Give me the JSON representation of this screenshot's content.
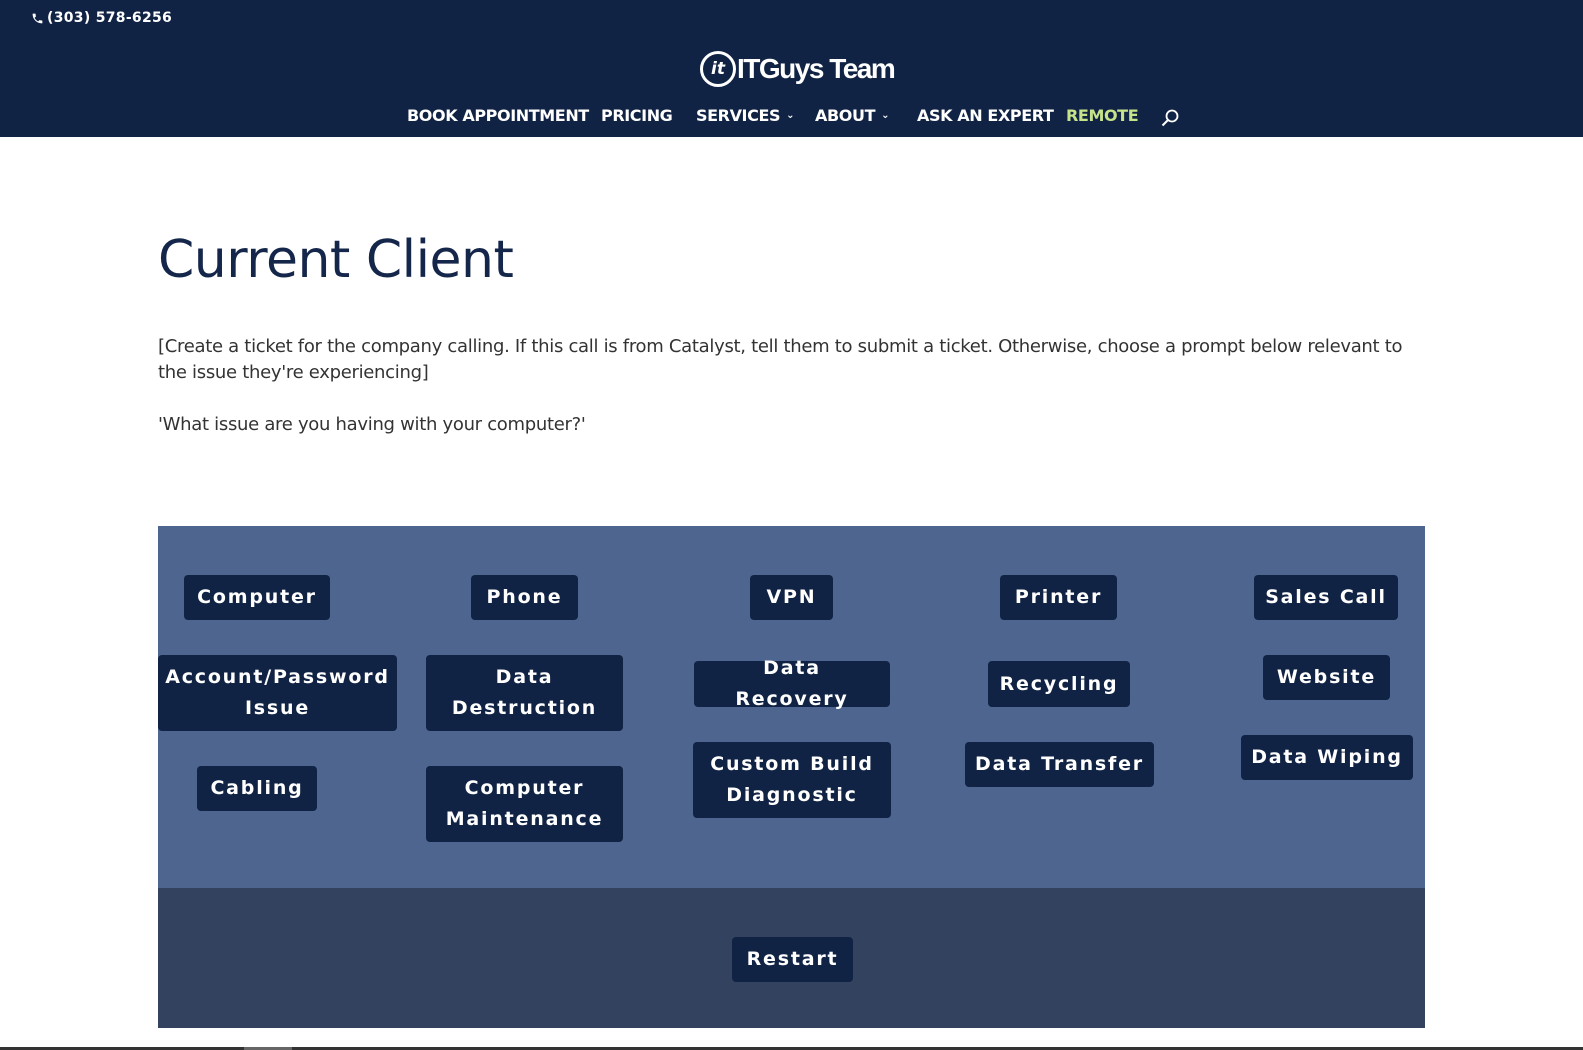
{
  "header": {
    "phone": "(303) 578-6256",
    "logo_mark": "it",
    "logo_text": "ITGuys Team",
    "nav": [
      {
        "label": "BOOK APPOINTMENT",
        "has_dropdown": false
      },
      {
        "label": "PRICING",
        "has_dropdown": false
      },
      {
        "label": "SERVICES",
        "has_dropdown": true
      },
      {
        "label": "ABOUT",
        "has_dropdown": true
      },
      {
        "label": "ASK AN EXPERT",
        "has_dropdown": false
      },
      {
        "label": "REMOTE",
        "has_dropdown": false
      }
    ],
    "icons": {
      "phone": "phone-icon",
      "search": "search-icon",
      "dropdown": "chevron-down-icon"
    }
  },
  "main": {
    "title": "Current Client",
    "instruction": "[Create a ticket for the company calling. If this call is from Catalyst, tell them to submit a ticket. Otherwise, choose a prompt below relevant to the issue they're experiencing]",
    "prompt": "'What issue are you having with your computer?'"
  },
  "buttons": {
    "computer": "Computer",
    "phone": "Phone",
    "vpn": "VPN",
    "printer": "Printer",
    "sales_call": "Sales Call",
    "account_password": "Account/Password Issue",
    "data_destruction": "Data Destruction",
    "data_recovery": "Data Recovery",
    "recycling": "Recycling",
    "website": "Website",
    "cabling": "Cabling",
    "computer_maintenance": "Computer Maintenance",
    "custom_build": "Custom Build Diagnostic",
    "data_transfer": "Data Transfer",
    "data_wiping": "Data Wiping",
    "restart": "Restart"
  },
  "colors": {
    "header_bg": "#112344",
    "remote_accent": "#c7e38a",
    "panel_bg": "#4e6590",
    "footer_panel_bg": "#33425f",
    "button_bg": "#112344",
    "title": "#14264a"
  }
}
